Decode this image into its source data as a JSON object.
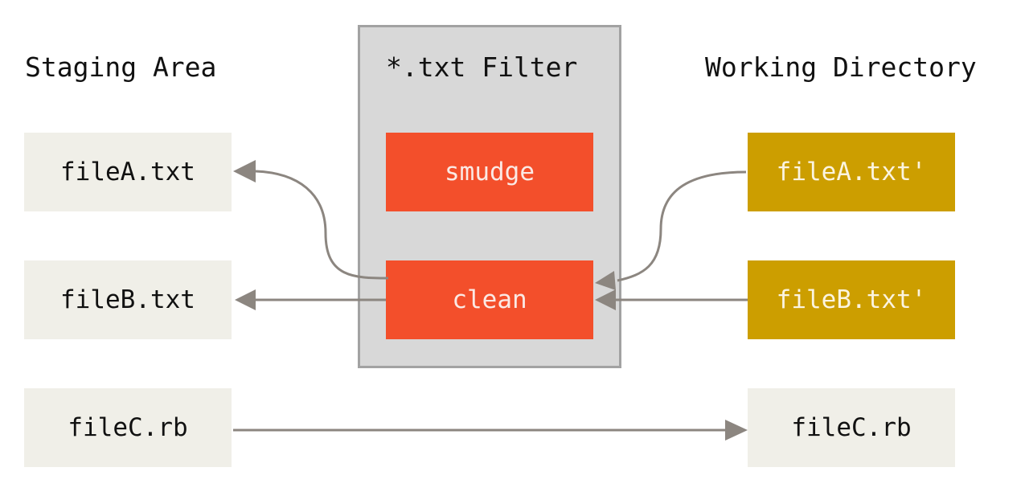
{
  "columns": {
    "staging": {
      "title": "Staging Area"
    },
    "filter": {
      "title": "*.txt Filter"
    },
    "working": {
      "title": "Working Directory"
    }
  },
  "staging_files": [
    "fileA.txt",
    "fileB.txt",
    "fileC.rb"
  ],
  "filter_steps": {
    "smudge": "smudge",
    "clean": "clean"
  },
  "working_files": [
    "fileA.txt'",
    "fileB.txt'",
    "fileC.rb"
  ],
  "colors": {
    "file_box": "#f0efe8",
    "filter_step": "#f34f2b",
    "working_filtered": "#cc9e00",
    "filter_panel": "#d8d8d8",
    "arrow": "#8c8680"
  },
  "connections": [
    {
      "from": "working_files.0",
      "to": "filter_steps.clean"
    },
    {
      "from": "filter_steps.clean",
      "to": "staging_files.0"
    },
    {
      "from": "working_files.1",
      "to": "filter_steps.clean"
    },
    {
      "from": "filter_steps.clean",
      "to": "staging_files.1"
    },
    {
      "from": "staging_files.2",
      "to": "working_files.2"
    }
  ]
}
